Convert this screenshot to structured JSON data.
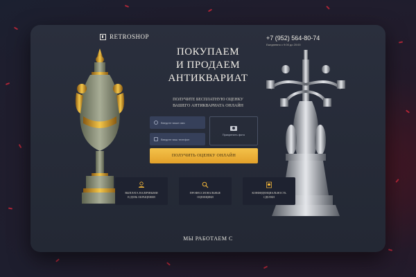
{
  "brand": {
    "name": "RETROSHOP"
  },
  "contact": {
    "phone": "+7 (952) 564-80-74",
    "hours": "Ежедневно с 9:00 до 20:00"
  },
  "hero": {
    "headline_line1": "ПОКУПАЕМ",
    "headline_line2": "И ПРОДАЕМ",
    "headline_line3": "АНТИКВАРИАТ",
    "sub_line1": "ПОЛУЧИТЕ БЕСПЛАТНУЮ ОЦЕНКУ",
    "sub_line2": "ВАШЕГО АНТИКВАРИАТА ОНЛАЙН"
  },
  "form": {
    "name_placeholder": "Введите ваше имя",
    "phone_placeholder": "Введите ваш телефон",
    "upload_label": "Прикрепить фото",
    "submit_label": "ПОЛУЧИТЬ ОЦЕНКУ ОНЛАЙН"
  },
  "features": [
    {
      "text": "ВЫПЛАТА НАЛИЧНЫМИ\nВ ДЕНЬ ОБРАЩЕНИЯ",
      "icon": "money-hand-icon"
    },
    {
      "text": "ПРОФЕССИОНАЛЬНЫЕ\nОЦЕНЩИКИ",
      "icon": "magnifier-icon"
    },
    {
      "text": "КОНФИДЕНЦИАЛЬНОСТЬ\nСДЕЛКИ",
      "icon": "document-icon"
    }
  ],
  "section": {
    "title": "МЫ РАБОТАЕМ С"
  },
  "colors": {
    "accent": "#f0b43a",
    "card": "#262b38",
    "petal": "#c8283a"
  }
}
